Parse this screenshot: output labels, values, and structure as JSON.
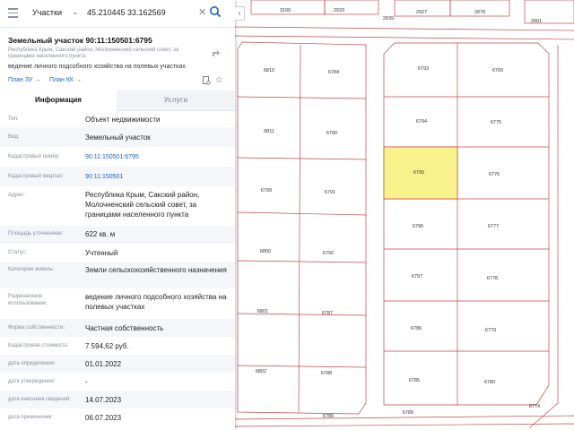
{
  "search": {
    "type_label": "Участки",
    "query": "45.210445 33.162569"
  },
  "parcel": {
    "title": "Земельный участок 90:11:150501:6795",
    "address_short": "Республика Крым, Сакский район, Молочненский сельский совет, за границами населенного пункта",
    "purpose": "ведение личного подсобного хозяйства на полевых участках",
    "links": {
      "plan_zu": "План ЗУ",
      "plan_kk": "План КК"
    }
  },
  "tabs": {
    "info": "Информация",
    "services": "Услуги"
  },
  "rows": [
    {
      "label": "Тип:",
      "value": "Объект недвижимости"
    },
    {
      "label": "Вид:",
      "value": "Земельный участок"
    },
    {
      "label": "Кадастровый номер:",
      "value": "90:11:150501:6795"
    },
    {
      "label": "Кадастровый квартал:",
      "value": "90:11:150501"
    },
    {
      "label": "Адрес:",
      "value": "Республика Крым, Сакский район, Молочненский сельский совет, за границами населенного пункта"
    },
    {
      "label": "Площадь уточненная:",
      "value": "622 кв. м"
    },
    {
      "label": "Статус:",
      "value": "Учтенный"
    },
    {
      "label": "Категория земель:",
      "value": "Земли сельскохозяйственного назначения"
    },
    {
      "label": "Разрешенное использование:",
      "value": "ведение личного подсобного хозяйства на полевых участках"
    },
    {
      "label": "Форма собственности:",
      "value": "Частная собственность"
    },
    {
      "label": "Кадастровая стоимость:",
      "value": "7 594,62 руб."
    },
    {
      "label": "дата определения:",
      "value": "01.01.2022"
    },
    {
      "label": "дата утверждения:",
      "value": "-"
    },
    {
      "label": "дата внесения сведений:",
      "value": "14.07.2023"
    },
    {
      "label": "дата применения:",
      "value": "06.07.2023"
    }
  ],
  "map": {
    "selected_parcel": "6795",
    "top_labels": [
      "3100",
      "2933",
      "2839",
      "2927",
      "2878",
      "2801"
    ],
    "parcels_col1": [
      "6810",
      "6811",
      "6799",
      "6800",
      "6801",
      "6802"
    ],
    "parcels_col2": [
      "6784",
      "6790",
      "6791",
      "6792",
      "6787",
      "6788",
      "6789"
    ],
    "parcels_col3": [
      "6793",
      "6794",
      "6795",
      "6796",
      "6797",
      "6786",
      "6785",
      "6789"
    ],
    "parcels_col4": [
      "6769",
      "6775",
      "6776",
      "6777",
      "6778",
      "6779",
      "6780"
    ],
    "other_labels": [
      "6774",
      "67"
    ]
  },
  "colors": {
    "accent": "#1a64c8",
    "selected_fill": "#f8f28a",
    "parcel_line": "#b03a3a"
  }
}
